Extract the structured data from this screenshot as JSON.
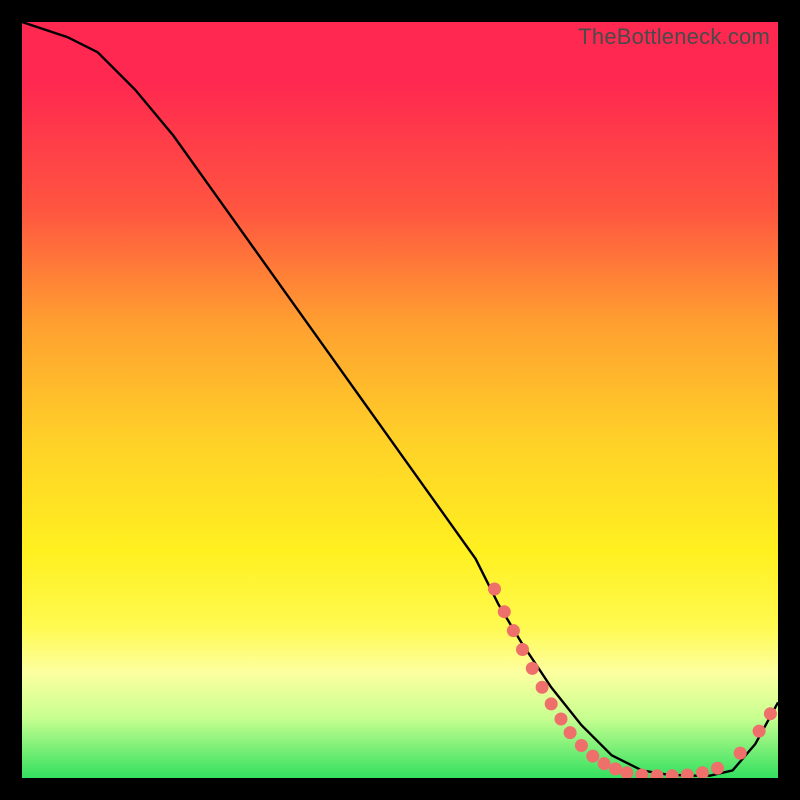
{
  "watermark": "TheBottleneck.com",
  "chart_data": {
    "type": "line",
    "title": "",
    "xlabel": "",
    "ylabel": "",
    "xlim": [
      0,
      100
    ],
    "ylim": [
      0,
      100
    ],
    "series": [
      {
        "name": "curve",
        "x": [
          0,
          6,
          10,
          15,
          20,
          25,
          30,
          35,
          40,
          45,
          50,
          55,
          60,
          63,
          66,
          70,
          74,
          78,
          82,
          85,
          88,
          91,
          94,
          97,
          100
        ],
        "y": [
          100,
          98,
          96,
          91,
          85,
          78,
          71,
          64,
          57,
          50,
          43,
          36,
          29,
          23,
          18,
          12,
          7,
          3,
          1,
          0.5,
          0.3,
          0.3,
          1,
          4.5,
          10
        ]
      }
    ],
    "markers": [
      {
        "x": 62.5,
        "y": 25.0
      },
      {
        "x": 63.8,
        "y": 22.0
      },
      {
        "x": 65.0,
        "y": 19.5
      },
      {
        "x": 66.2,
        "y": 17.0
      },
      {
        "x": 67.5,
        "y": 14.5
      },
      {
        "x": 68.8,
        "y": 12.0
      },
      {
        "x": 70.0,
        "y": 9.8
      },
      {
        "x": 71.3,
        "y": 7.8
      },
      {
        "x": 72.5,
        "y": 6.0
      },
      {
        "x": 74.0,
        "y": 4.3
      },
      {
        "x": 75.5,
        "y": 2.9
      },
      {
        "x": 77.0,
        "y": 1.9
      },
      {
        "x": 78.5,
        "y": 1.2
      },
      {
        "x": 80.0,
        "y": 0.7
      },
      {
        "x": 82.0,
        "y": 0.4
      },
      {
        "x": 84.0,
        "y": 0.3
      },
      {
        "x": 86.0,
        "y": 0.3
      },
      {
        "x": 88.0,
        "y": 0.4
      },
      {
        "x": 90.0,
        "y": 0.7
      },
      {
        "x": 92.0,
        "y": 1.3
      },
      {
        "x": 95.0,
        "y": 3.3
      },
      {
        "x": 97.5,
        "y": 6.2
      },
      {
        "x": 99.0,
        "y": 8.5
      }
    ]
  }
}
